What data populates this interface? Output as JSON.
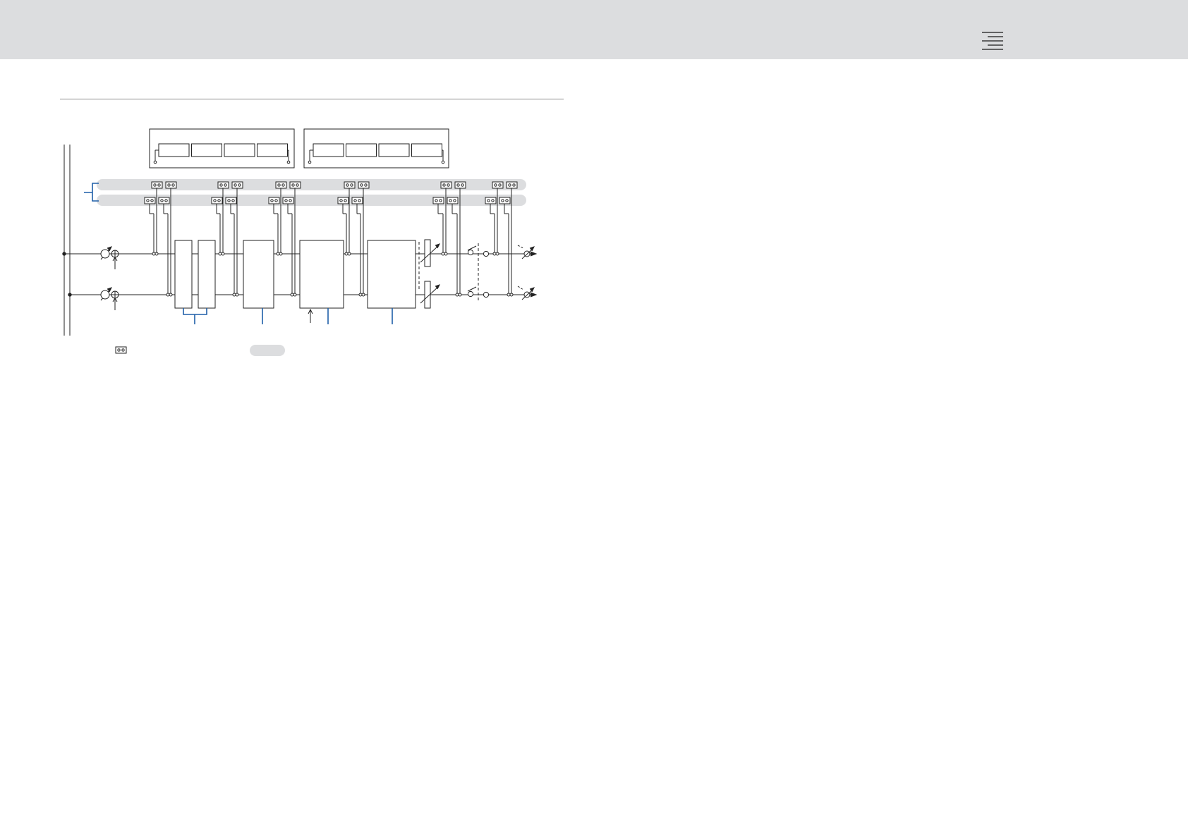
{
  "page": {
    "title": "",
    "background": "#ffffff"
  },
  "header": {
    "background": "#dcdddf",
    "menu_icon": "menu-lines-icon"
  },
  "diagram": {
    "channels": 2,
    "buses": 2,
    "bus_color": "#dcdddf",
    "accent_color": "#1f5fa8",
    "line_color": "#222222",
    "top_panels": [
      {
        "slots": 4
      },
      {
        "slots": 4
      }
    ],
    "blocks": 5,
    "legend": {
      "jack_icon": "patch-jack-icon",
      "bus_swatch": "bus-swatch"
    }
  }
}
